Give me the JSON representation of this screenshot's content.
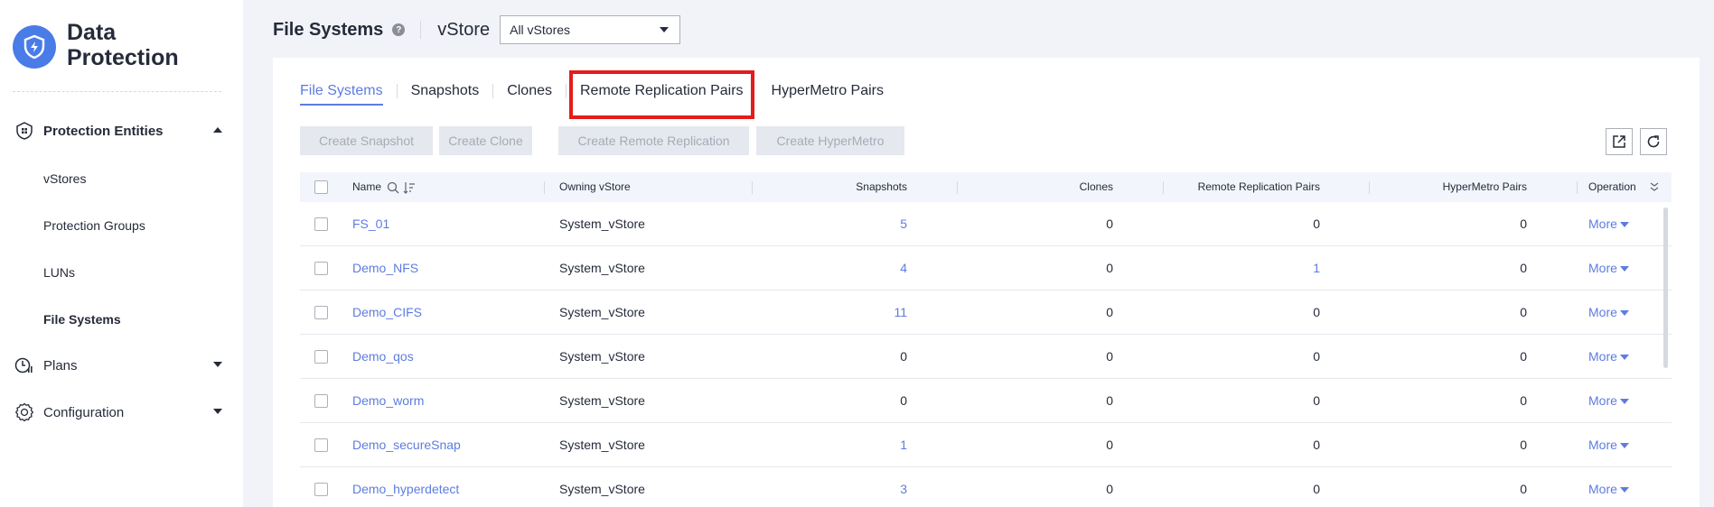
{
  "app": {
    "title_line1": "Data",
    "title_line2": "Protection"
  },
  "sidebar": {
    "groups": [
      {
        "label": "Protection Entities",
        "icon": "protection-entities-icon",
        "expanded": true
      },
      {
        "label": "Plans",
        "icon": "plans-icon",
        "expanded": false
      },
      {
        "label": "Configuration",
        "icon": "gear-icon",
        "expanded": false
      }
    ],
    "items": [
      {
        "label": "vStores"
      },
      {
        "label": "Protection Groups"
      },
      {
        "label": "LUNs"
      },
      {
        "label": "File Systems",
        "active": true
      }
    ]
  },
  "header": {
    "title": "File Systems",
    "help": "?",
    "vstore_label": "vStore",
    "vstore_value": "All vStores"
  },
  "tabs": [
    {
      "label": "File Systems",
      "active": true
    },
    {
      "label": "Snapshots"
    },
    {
      "label": "Clones"
    },
    {
      "label": "Remote Replication Pairs",
      "highlighted": true
    },
    {
      "label": "HyperMetro Pairs"
    }
  ],
  "actions": {
    "create_snapshot": "Create Snapshot",
    "create_clone": "Create Clone",
    "create_remote_replication": "Create Remote Replication",
    "create_hypermetro": "Create HyperMetro"
  },
  "table": {
    "columns": {
      "name": "Name",
      "owning_vstore": "Owning vStore",
      "snapshots": "Snapshots",
      "clones": "Clones",
      "remote_replication_pairs": "Remote Replication Pairs",
      "hypermetro_pairs": "HyperMetro Pairs",
      "operation": "Operation"
    },
    "rows": [
      {
        "name": "FS_01",
        "vstore": "System_vStore",
        "snapshots": "5",
        "clones": "0",
        "remote": "0",
        "hypermetro": "0",
        "operation": "More"
      },
      {
        "name": "Demo_NFS",
        "vstore": "System_vStore",
        "snapshots": "4",
        "clones": "0",
        "remote": "1",
        "hypermetro": "0",
        "operation": "More"
      },
      {
        "name": "Demo_CIFS",
        "vstore": "System_vStore",
        "snapshots": "11",
        "clones": "0",
        "remote": "0",
        "hypermetro": "0",
        "operation": "More"
      },
      {
        "name": "Demo_qos",
        "vstore": "System_vStore",
        "snapshots": "0",
        "clones": "0",
        "remote": "0",
        "hypermetro": "0",
        "operation": "More"
      },
      {
        "name": "Demo_worm",
        "vstore": "System_vStore",
        "snapshots": "0",
        "clones": "0",
        "remote": "0",
        "hypermetro": "0",
        "operation": "More"
      },
      {
        "name": "Demo_secureSnap",
        "vstore": "System_vStore",
        "snapshots": "1",
        "clones": "0",
        "remote": "0",
        "hypermetro": "0",
        "operation": "More"
      },
      {
        "name": "Demo_hyperdetect",
        "vstore": "System_vStore",
        "snapshots": "3",
        "clones": "0",
        "remote": "0",
        "hypermetro": "0",
        "operation": "More"
      }
    ]
  },
  "colors": {
    "accent": "#5e7ce0",
    "highlight": "#e31c1c",
    "brand": "#4a7ce8"
  }
}
